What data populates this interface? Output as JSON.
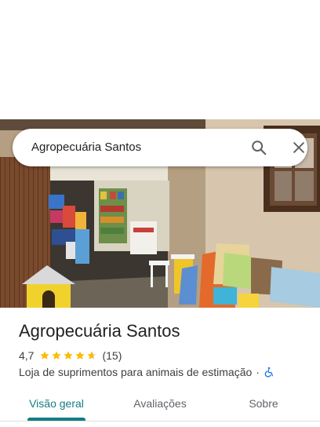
{
  "search": {
    "query": "Agropecuária Santos"
  },
  "icons": {
    "search": "search-icon",
    "close": "close-icon",
    "star": "star-icon",
    "accessibility": "wheelchair-icon"
  },
  "place": {
    "name": "Agropecuária Santos",
    "rating": "4,7",
    "rating_value": 4.7,
    "review_count": "(15)",
    "category": "Loja de suprimentos para animais de estimação",
    "separator": "·"
  },
  "tabs": [
    {
      "label": "Visão geral",
      "active": true
    },
    {
      "label": "Avaliações",
      "active": false
    },
    {
      "label": "Sobre",
      "active": false
    }
  ],
  "colors": {
    "accent": "#137c82",
    "star": "#fbbc04",
    "accessibility_icon": "#1a73e8"
  }
}
